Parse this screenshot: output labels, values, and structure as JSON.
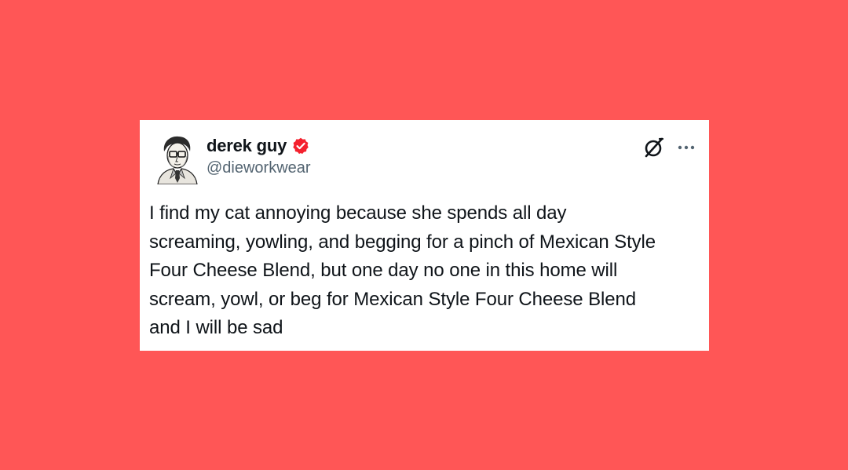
{
  "page": {
    "background_color": "#FF5656"
  },
  "tweet": {
    "author": {
      "display_name": "derek guy",
      "handle": "@dieworkwear",
      "verified": true,
      "verified_badge_color": "#F4212E",
      "avatar_icon": "avatar-illustration-icon"
    },
    "icons": {
      "grok": "grok-icon",
      "more": "more-icon"
    },
    "text": "I find my cat annoying because she spends all day\nscreaming, yowling, and begging for a pinch of Mexican Style\nFour Cheese Blend, but one day no one in this home will\nscream, yowl, or beg for Mexican Style Four Cheese Blend\nand I will be sad"
  }
}
